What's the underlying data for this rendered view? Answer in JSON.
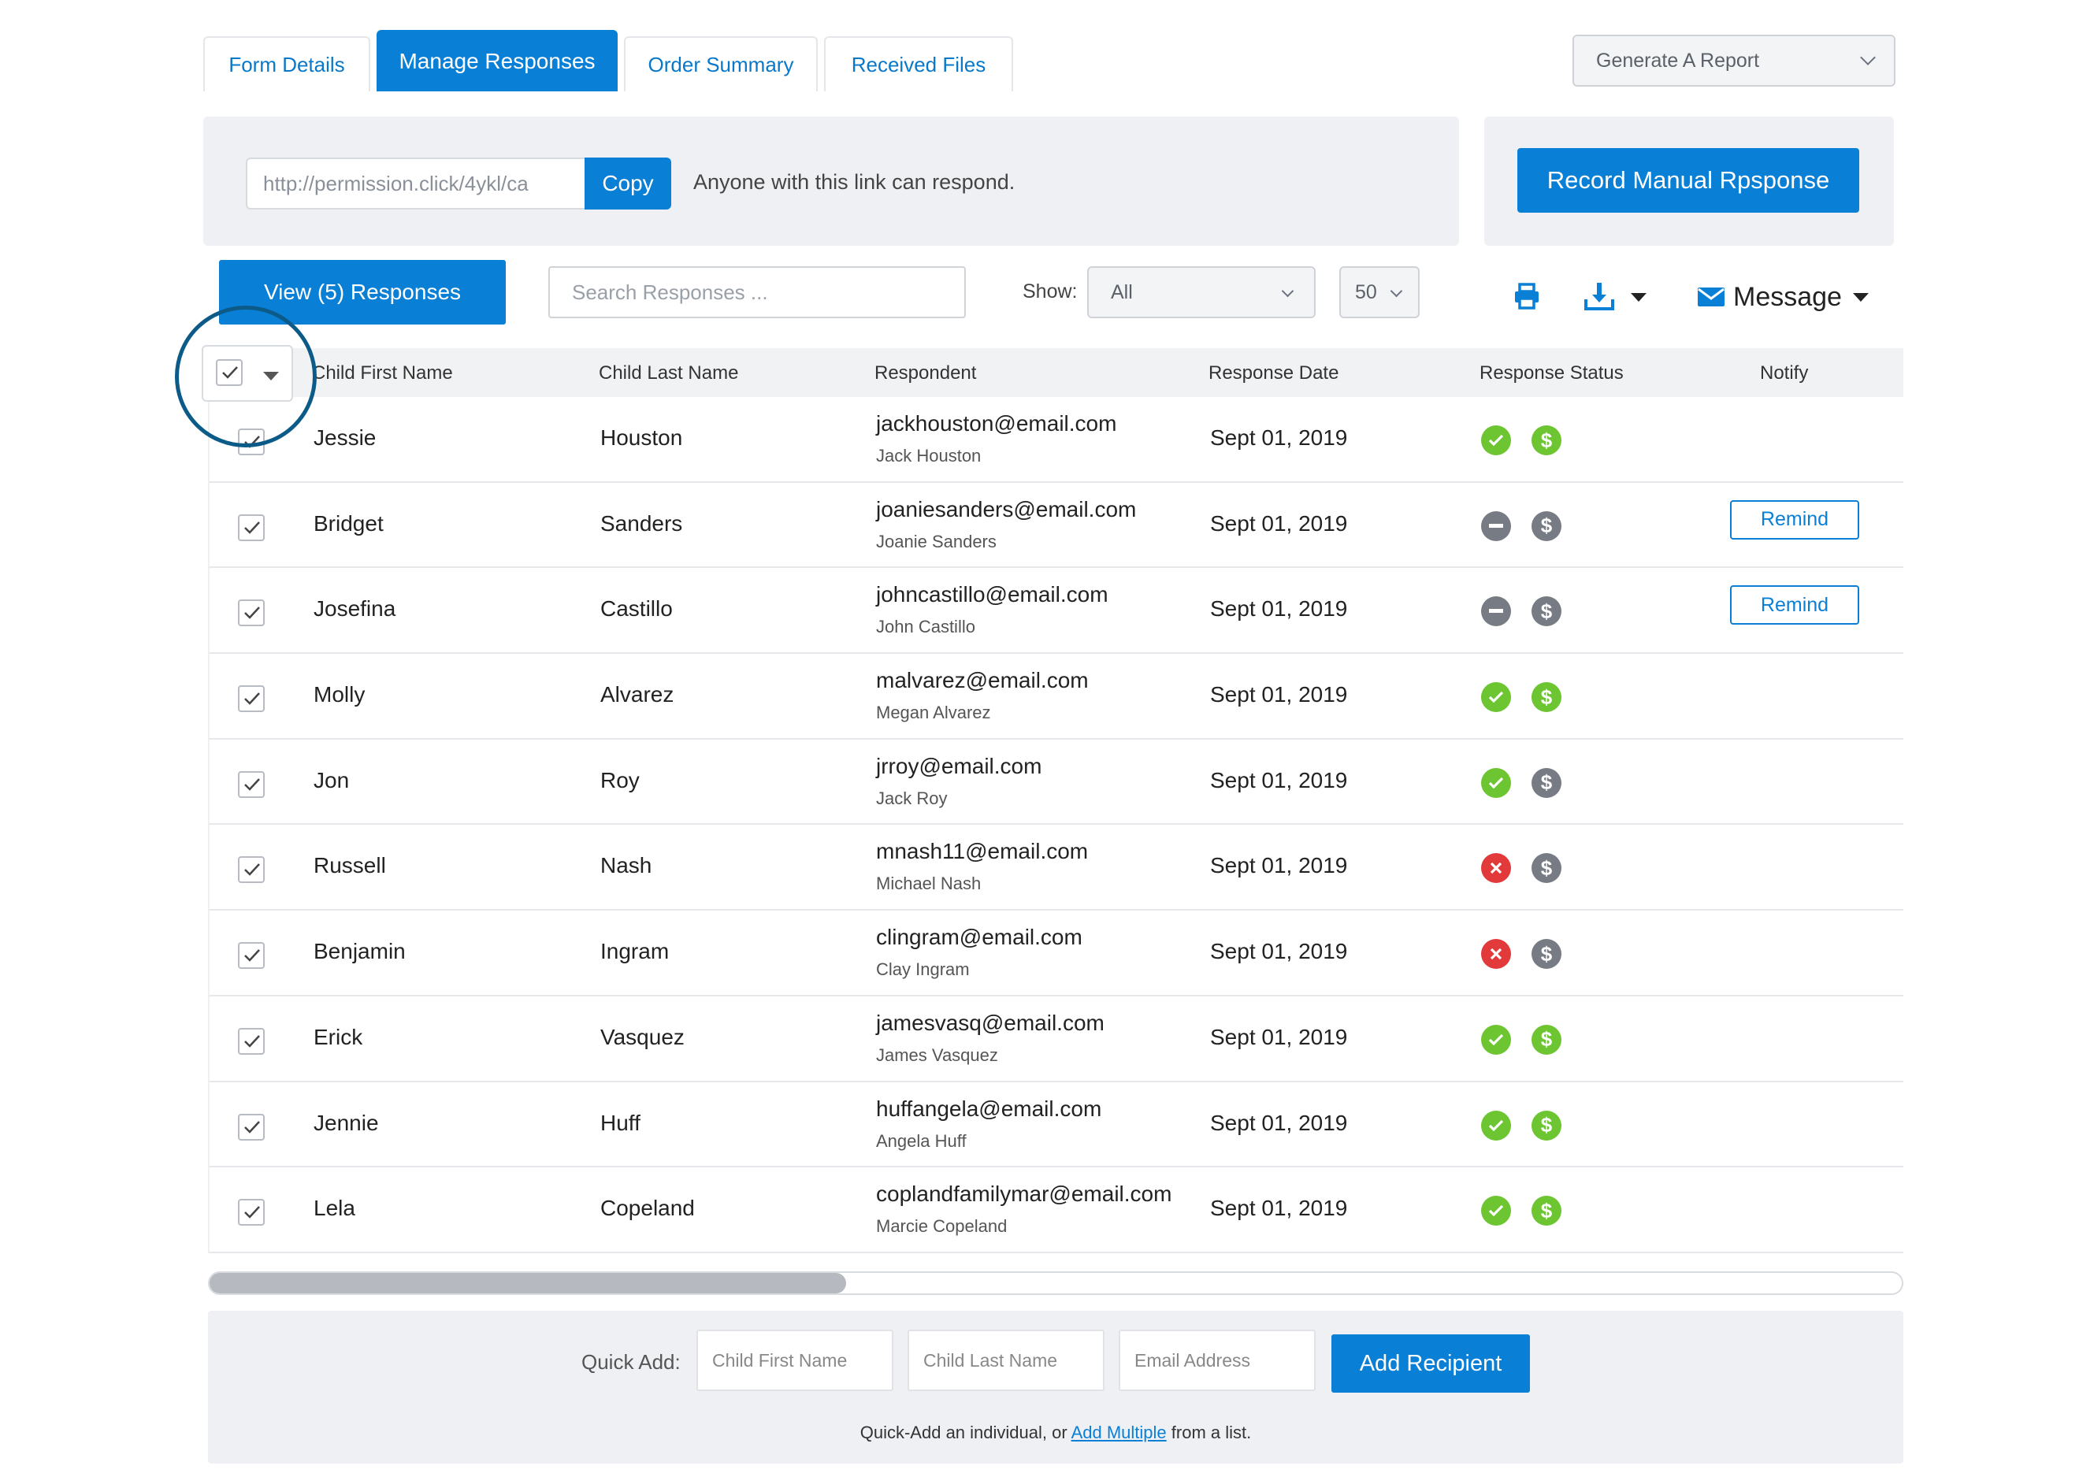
{
  "tabs": [
    {
      "label": "Form Details"
    },
    {
      "label": "Manage Responses"
    },
    {
      "label": "Order Summary"
    },
    {
      "label": "Received Files"
    }
  ],
  "report": {
    "label": "Generate A Report"
  },
  "share": {
    "link": "http://permission.click/4ykl/ca",
    "copy_label": "Copy",
    "note": "Anyone with this link can respond."
  },
  "manual": {
    "label": "Record Manual Rpsponse"
  },
  "toolbar": {
    "view_label": "View (5) Responses",
    "search_placeholder": "Search Responses ...",
    "show_label": "Show:",
    "show_value": "All",
    "count_value": "50",
    "message_label": "Message"
  },
  "columns": {
    "first": "Child First Name",
    "last": "Child Last Name",
    "respondent": "Respondent",
    "date": "Response Date",
    "status": "Response Status",
    "notify": "Notify"
  },
  "remind_label": "Remind",
  "rows": [
    {
      "first": "Jessie",
      "last": "Houston",
      "email": "jackhouston@email.com",
      "name": "Jack Houston",
      "date": "Sept 01, 2019",
      "status": "complete",
      "payment": "paid",
      "remind": false
    },
    {
      "first": "Bridget",
      "last": "Sanders",
      "email": "joaniesanders@email.com",
      "name": "Joanie Sanders",
      "date": "Sept 01, 2019",
      "status": "pending",
      "payment": "unpaid",
      "remind": true
    },
    {
      "first": "Josefina",
      "last": "Castillo",
      "email": "johncastillo@email.com",
      "name": "John Castillo",
      "date": "Sept 01, 2019",
      "status": "pending",
      "payment": "unpaid",
      "remind": true
    },
    {
      "first": "Molly",
      "last": "Alvarez",
      "email": "malvarez@email.com",
      "name": "Megan Alvarez",
      "date": "Sept 01, 2019",
      "status": "complete",
      "payment": "paid",
      "remind": false
    },
    {
      "first": "Jon",
      "last": "Roy",
      "email": "jrroy@email.com",
      "name": "Jack Roy",
      "date": "Sept 01, 2019",
      "status": "complete",
      "payment": "unpaid",
      "remind": false
    },
    {
      "first": "Russell",
      "last": "Nash",
      "email": "mnash11@email.com",
      "name": "Michael Nash",
      "date": "Sept 01, 2019",
      "status": "declined",
      "payment": "unpaid",
      "remind": false
    },
    {
      "first": "Benjamin",
      "last": "Ingram",
      "email": "clingram@email.com",
      "name": "Clay Ingram",
      "date": "Sept 01, 2019",
      "status": "declined",
      "payment": "unpaid",
      "remind": false
    },
    {
      "first": "Erick",
      "last": "Vasquez",
      "email": "jamesvasq@email.com",
      "name": "James Vasquez",
      "date": "Sept 01, 2019",
      "status": "complete",
      "payment": "paid",
      "remind": false
    },
    {
      "first": "Jennie",
      "last": "Huff",
      "email": "huffangela@email.com",
      "name": "Angela Huff",
      "date": "Sept 01, 2019",
      "status": "complete",
      "payment": "paid",
      "remind": false
    },
    {
      "first": "Lela",
      "last": "Copeland",
      "email": "coplandfamilymar@email.com",
      "name": "Marcie Copeland",
      "date": "Sept 01, 2019",
      "status": "complete",
      "payment": "paid",
      "remind": false
    }
  ],
  "scroll": {
    "position": 0.37
  },
  "quick_add": {
    "label": "Quick Add:",
    "first_placeholder": "Child First Name",
    "last_placeholder": "Child Last Name",
    "email_placeholder": "Email Address",
    "add_label": "Add Recipient",
    "note_prefix": "Quick-Add an individual, or",
    "note_link": "Add Multiple",
    "note_suffix": "from a list."
  },
  "colors": {
    "accent": "#0a7fd6",
    "complete": "#6cc531",
    "pending": "#767b84",
    "declined": "#e23a3a",
    "paid": "#6cc531",
    "unpaid": "#767b84"
  }
}
